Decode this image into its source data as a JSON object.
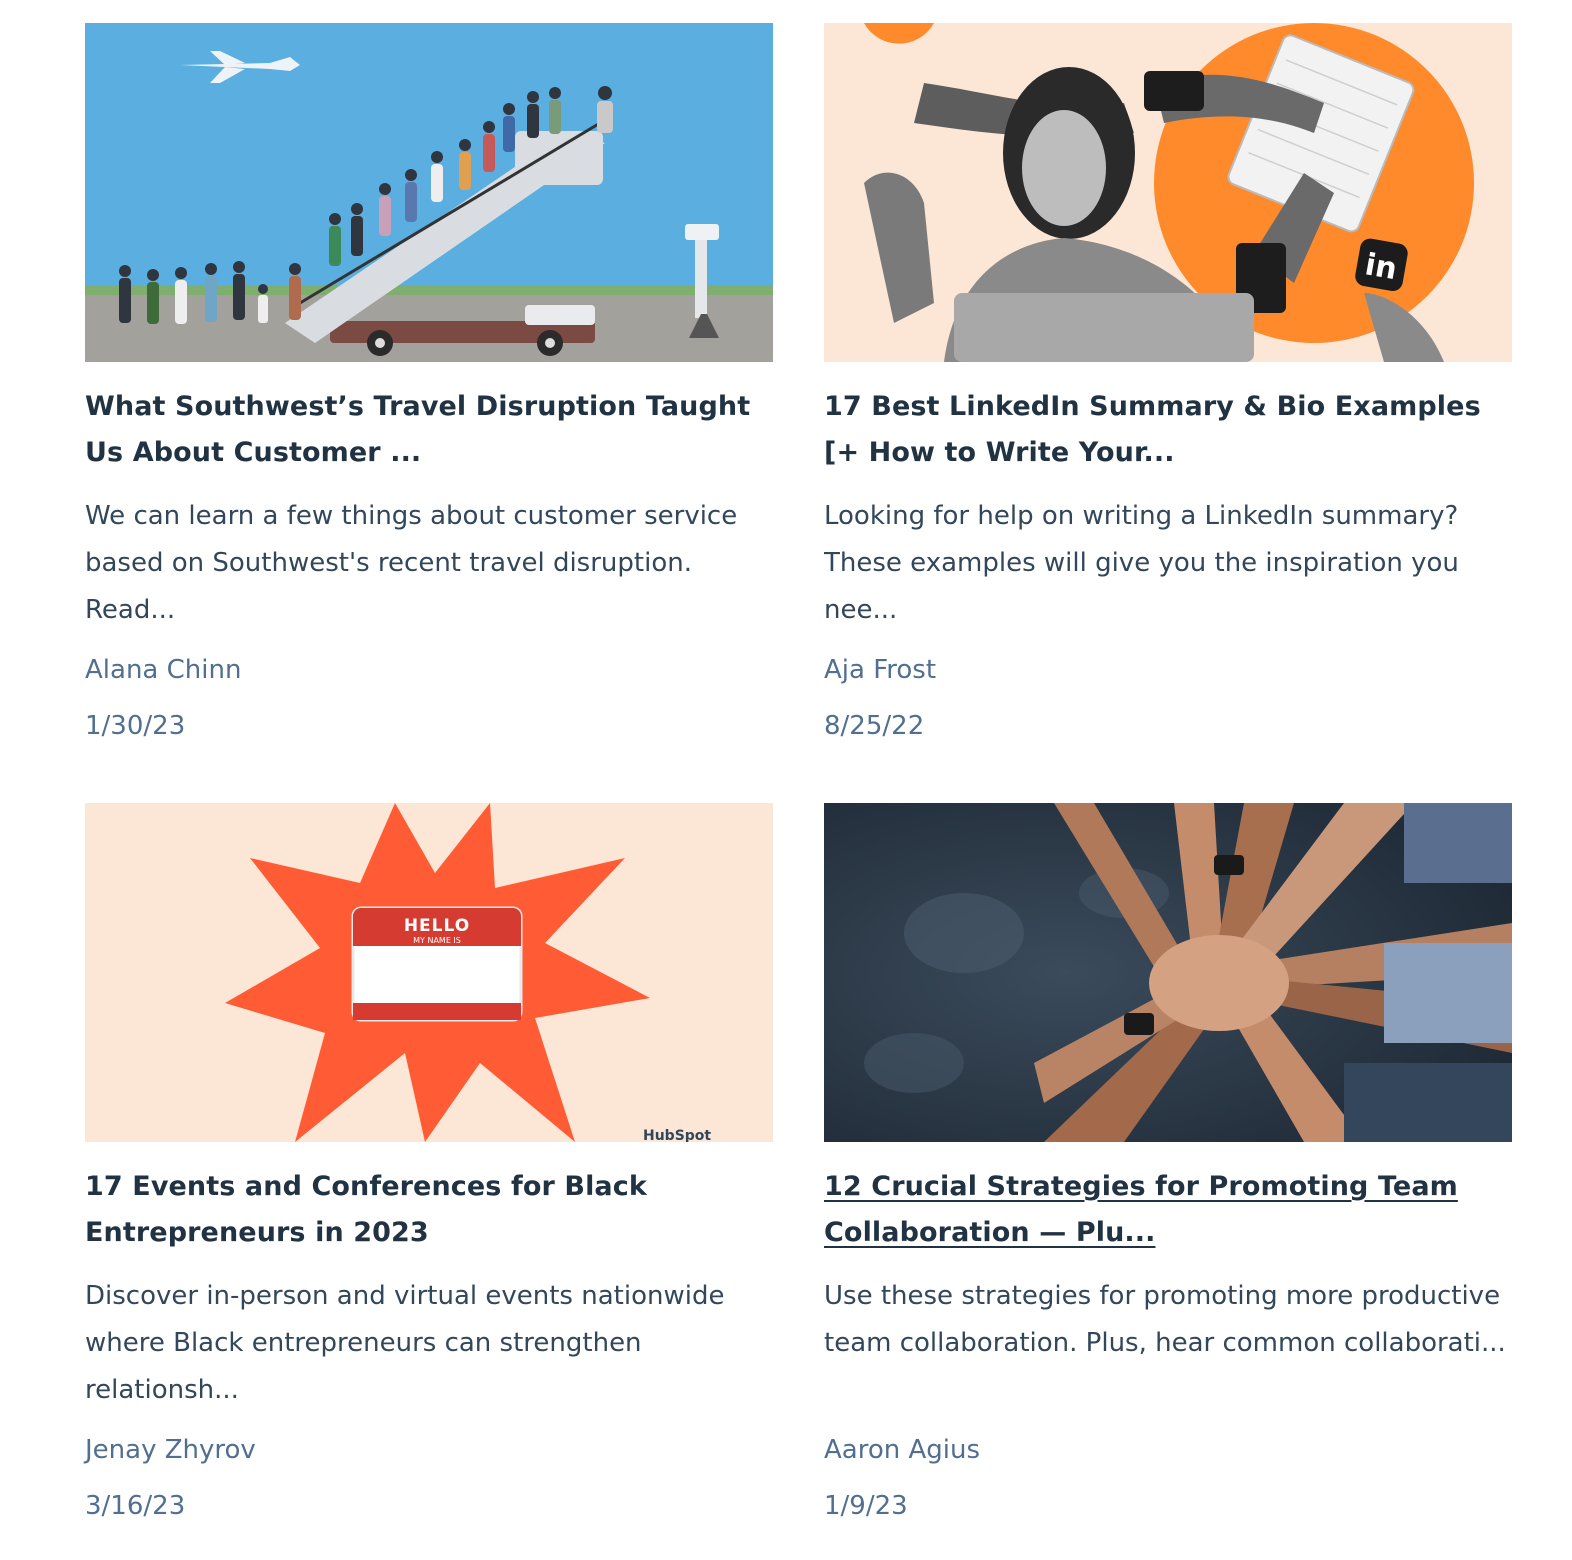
{
  "cards": [
    {
      "title": "What Southwest’s Travel Disruption Taught Us About Customer ...",
      "description": "We can learn a few things about customer service based on Southwest's recent travel disruption. Read...",
      "author": "Alana Chinn",
      "date": "1/30/23",
      "image": "airplane-boarding-stairs-illustration"
    },
    {
      "title": "17 Best LinkedIn Summary & Bio Examples [+ How to Write Your...",
      "description": "Looking for help on writing a LinkedIn summary? These examples will give you the inspiration you nee...",
      "author": "Aja Frost",
      "date": "8/25/22",
      "image": "woman-multitasking-linkedin-collage",
      "image_badge": "in"
    },
    {
      "title": "17 Events and Conferences for Black Entrepreneurs in 2023",
      "description": "Discover in-person and virtual events nationwide where Black entrepreneurs can strengthen relationsh...",
      "author": "Jenay Zhyrov",
      "date": "3/16/23",
      "image": "hello-name-tag-starburst-illustration",
      "image_text": {
        "hello": "HELLO",
        "my_name_is": "MY NAME IS",
        "brand": "HubSpot"
      }
    },
    {
      "title": "12 Crucial Strategies for Promoting Team Collaboration — Plu...",
      "description": "Use these strategies for promoting more productive team collaboration. Plus, hear common collaborati...",
      "author": "Aaron Agius",
      "date": "1/9/23",
      "image": "team-hands-stacked-photo"
    }
  ],
  "colors": {
    "title": "#213343",
    "body": "#33475b",
    "meta": "#516f90",
    "hubspot_orange": "#ff5c35"
  }
}
